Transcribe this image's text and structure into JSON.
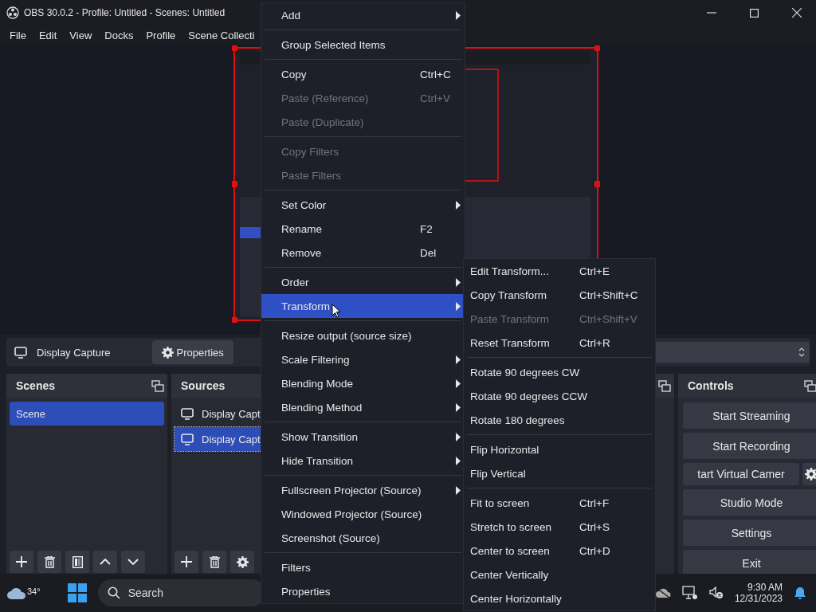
{
  "window": {
    "title": "OBS 30.0.2 - Profile: Untitled - Scenes: Untitled"
  },
  "menu_bar": [
    "File",
    "Edit",
    "View",
    "Docks",
    "Profile",
    "Scene Collecti"
  ],
  "source_toolbar": {
    "source_name": "Display Capture",
    "properties_button": "Properties"
  },
  "scenes": {
    "title": "Scenes",
    "items": [
      {
        "label": "Scene",
        "selected": true
      }
    ]
  },
  "sources": {
    "title": "Sources",
    "items": [
      {
        "label": "Display Capt",
        "selected": false
      },
      {
        "label": "Display Capt",
        "selected": true
      }
    ]
  },
  "controls": {
    "title": "Controls",
    "buttons": [
      "Start Streaming",
      "Start Recording",
      "tart Virtual Camer",
      "Studio Mode",
      "Settings",
      "Exit"
    ]
  },
  "context_menu": {
    "groups": [
      [
        {
          "label": "Add",
          "submenu": true,
          "disabled": false,
          "selected": false
        }
      ],
      [
        {
          "label": "Group Selected Items",
          "submenu": false,
          "disabled": false,
          "selected": false
        }
      ],
      [
        {
          "label": "Copy",
          "shortcut": "Ctrl+C",
          "submenu": false,
          "disabled": false,
          "selected": false
        },
        {
          "label": "Paste (Reference)",
          "shortcut": "Ctrl+V",
          "submenu": false,
          "disabled": true,
          "selected": false
        },
        {
          "label": "Paste (Duplicate)",
          "submenu": false,
          "disabled": true,
          "selected": false
        }
      ],
      [
        {
          "label": "Copy Filters",
          "submenu": false,
          "disabled": true,
          "selected": false
        },
        {
          "label": "Paste Filters",
          "submenu": false,
          "disabled": true,
          "selected": false
        }
      ],
      [
        {
          "label": "Set Color",
          "submenu": true,
          "disabled": false,
          "selected": false
        },
        {
          "label": "Rename",
          "shortcut": "F2",
          "submenu": false,
          "disabled": false,
          "selected": false
        },
        {
          "label": "Remove",
          "shortcut": "Del",
          "submenu": false,
          "disabled": false,
          "selected": false
        }
      ],
      [
        {
          "label": "Order",
          "submenu": true,
          "disabled": false,
          "selected": false
        },
        {
          "label": "Transform",
          "submenu": true,
          "disabled": false,
          "selected": true
        }
      ],
      [
        {
          "label": "Resize output (source size)",
          "submenu": false,
          "disabled": false,
          "selected": false
        },
        {
          "label": "Scale Filtering",
          "submenu": true,
          "disabled": false,
          "selected": false
        },
        {
          "label": "Blending Mode",
          "submenu": true,
          "disabled": false,
          "selected": false
        },
        {
          "label": "Blending Method",
          "submenu": true,
          "disabled": false,
          "selected": false
        }
      ],
      [
        {
          "label": "Show Transition",
          "submenu": true,
          "disabled": false,
          "selected": false
        },
        {
          "label": "Hide Transition",
          "submenu": true,
          "disabled": false,
          "selected": false
        }
      ],
      [
        {
          "label": "Fullscreen Projector (Source)",
          "submenu": true,
          "disabled": false,
          "selected": false
        },
        {
          "label": "Windowed Projector (Source)",
          "submenu": false,
          "disabled": false,
          "selected": false
        },
        {
          "label": "Screenshot (Source)",
          "submenu": false,
          "disabled": false,
          "selected": false
        }
      ],
      [
        {
          "label": "Filters",
          "submenu": false,
          "disabled": false,
          "selected": false
        },
        {
          "label": "Properties",
          "submenu": false,
          "disabled": false,
          "selected": false
        }
      ]
    ]
  },
  "transform_submenu": {
    "groups": [
      [
        {
          "label": "Edit Transform...",
          "shortcut": "Ctrl+E",
          "disabled": false
        },
        {
          "label": "Copy Transform",
          "shortcut": "Ctrl+Shift+C",
          "disabled": false
        },
        {
          "label": "Paste Transform",
          "shortcut": "Ctrl+Shift+V",
          "disabled": true
        },
        {
          "label": "Reset Transform",
          "shortcut": "Ctrl+R",
          "disabled": false
        }
      ],
      [
        {
          "label": "Rotate 90 degrees CW",
          "disabled": false
        },
        {
          "label": "Rotate 90 degrees CCW",
          "disabled": false
        },
        {
          "label": "Rotate 180 degrees",
          "disabled": false
        }
      ],
      [
        {
          "label": "Flip Horizontal",
          "disabled": false
        },
        {
          "label": "Flip Vertical",
          "disabled": false
        }
      ],
      [
        {
          "label": "Fit to screen",
          "shortcut": "Ctrl+F",
          "disabled": false
        },
        {
          "label": "Stretch to screen",
          "shortcut": "Ctrl+S",
          "disabled": false
        },
        {
          "label": "Center to screen",
          "shortcut": "Ctrl+D",
          "disabled": false
        },
        {
          "label": "Center Vertically",
          "disabled": false
        },
        {
          "label": "Center Horizontally",
          "disabled": false
        }
      ]
    ]
  },
  "taskbar": {
    "weather": "34°",
    "search_placeholder": "Search",
    "time": "9:30 AM",
    "date": "12/31/2023"
  }
}
